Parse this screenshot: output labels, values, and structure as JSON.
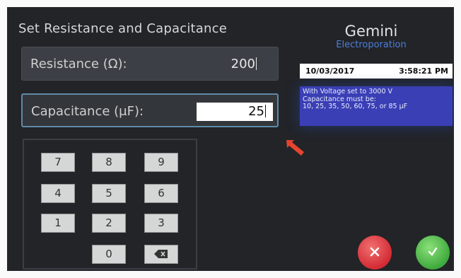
{
  "screen": {
    "title": "Set Resistance and Capacitance"
  },
  "fields": {
    "resistance": {
      "label": "Resistance (Ω):",
      "value": "200"
    },
    "capacitance": {
      "label": "Capacitance (μF):",
      "value": "25"
    }
  },
  "keypad": {
    "keys": [
      "7",
      "8",
      "9",
      "4",
      "5",
      "6",
      "1",
      "2",
      "3",
      "0"
    ],
    "backspace_icon": "backspace-icon"
  },
  "brand": {
    "name": "Gemini",
    "subtitle": "Electroporation"
  },
  "status": {
    "date": "10/03/2017",
    "time": "3:58:21 PM"
  },
  "note": {
    "line1": "With Voltage set to 3000 V",
    "line2": "Capacitance must be:",
    "line3": "10, 25, 35, 50, 60, 75, or 85 μF"
  },
  "buttons": {
    "cancel_icon": "close-icon",
    "confirm_icon": "check-icon"
  },
  "colors": {
    "background": "#222428",
    "accent_blue": "#3a3fb5",
    "focus_border": "#5f8aa8",
    "cancel": "#d42b34",
    "confirm": "#3faa3d",
    "arrow": "#e5442f"
  }
}
